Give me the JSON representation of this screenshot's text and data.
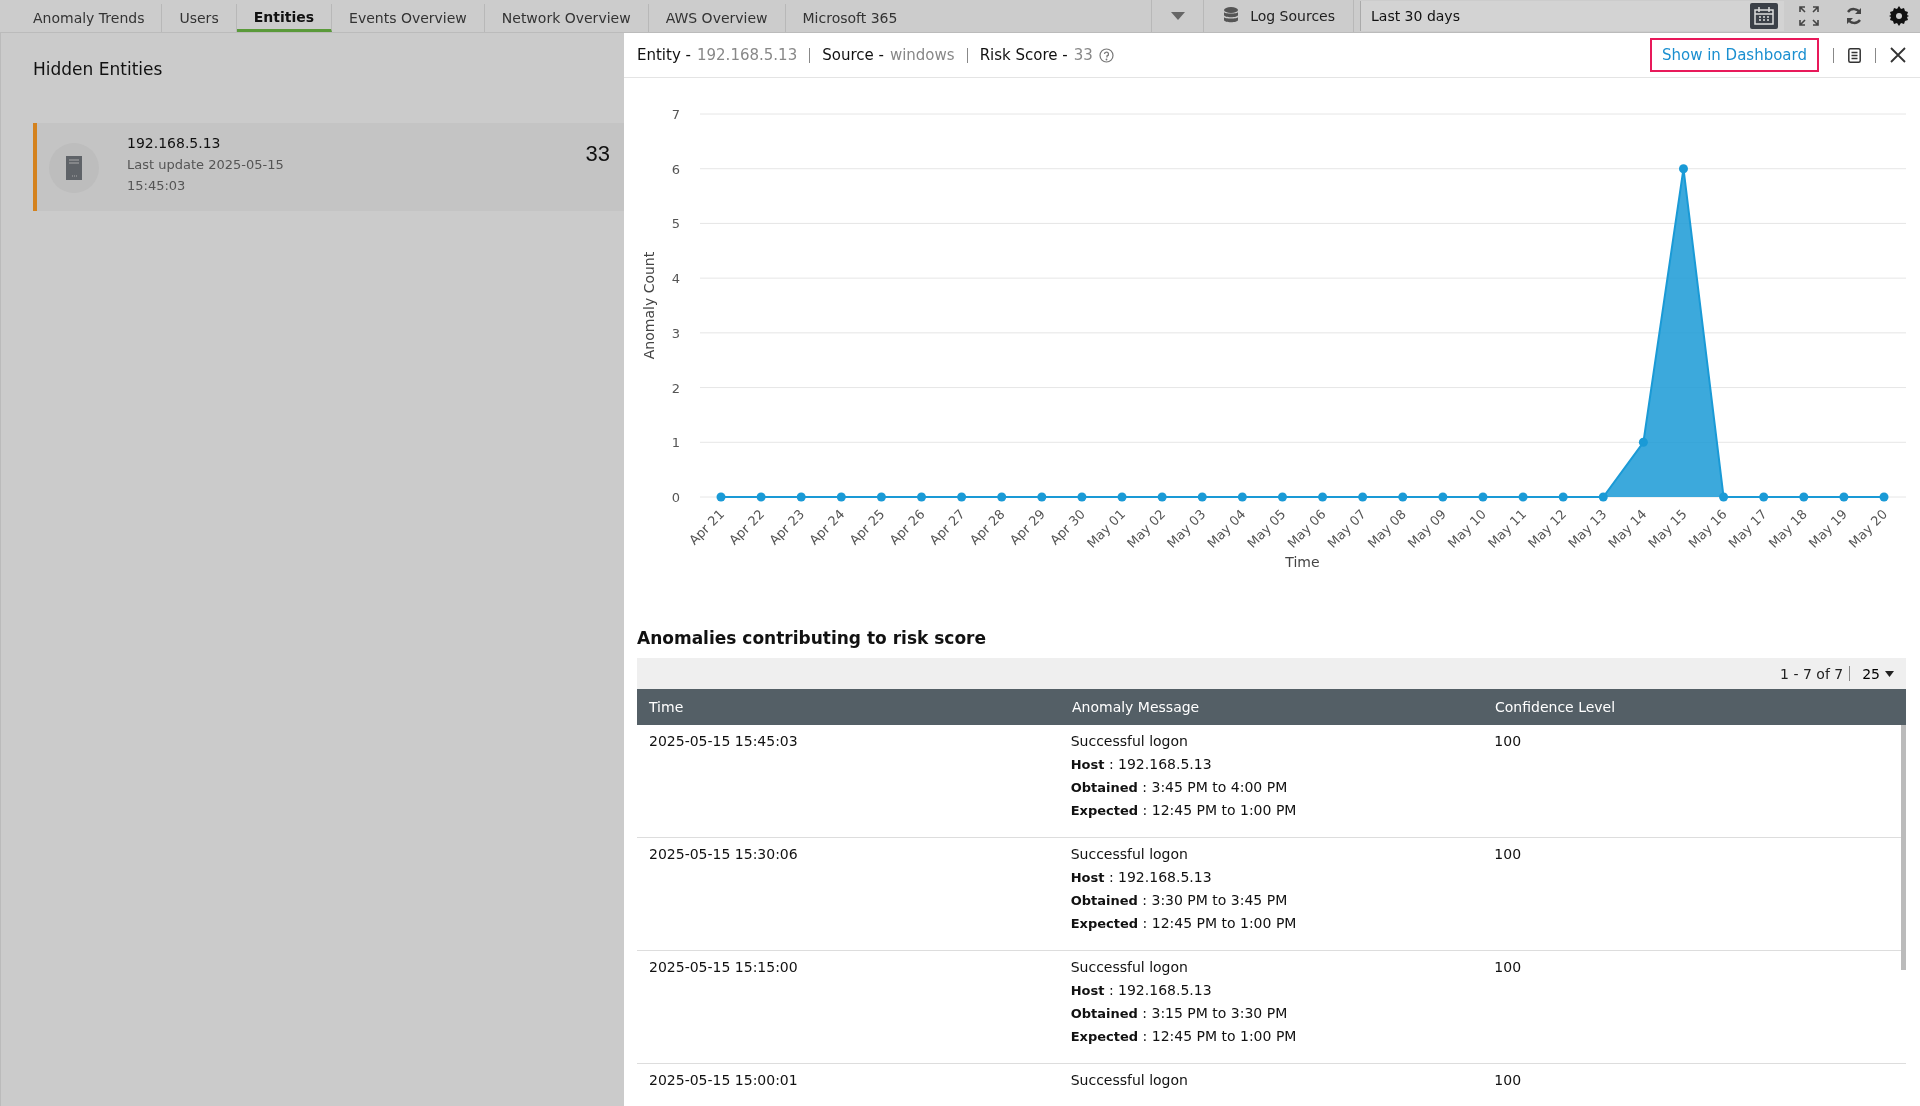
{
  "tabs": [
    {
      "label": "Anomaly Trends",
      "selected": false
    },
    {
      "label": "Users",
      "selected": false
    },
    {
      "label": "Entities",
      "selected": true
    },
    {
      "label": "Events Overview",
      "selected": false
    },
    {
      "label": "Network Overview",
      "selected": false
    },
    {
      "label": "AWS Overview",
      "selected": false
    },
    {
      "label": "Microsoft 365",
      "selected": false
    }
  ],
  "toolbar": {
    "log_sources": "Log Sources",
    "date_range": "Last 30 days"
  },
  "hidden_entities": {
    "title": "Hidden Entities",
    "items": [
      {
        "name": "192.168.5.13",
        "updated": "Last update 2025-05-15",
        "updated_time": "15:45:03",
        "score": "33",
        "selected": true
      }
    ]
  },
  "detail": {
    "entity_label": "Entity -",
    "entity": "192.168.5.13",
    "source_label": "Source -",
    "source": "windows",
    "risk_label": "Risk Score -",
    "risk": "33",
    "show_button": "Show in Dashboard",
    "chart_data": {
      "type": "area",
      "grid": true,
      "xlabel": "Time",
      "ylabel": "Anomaly Count",
      "yticks": [
        0,
        1,
        2,
        3,
        4,
        5,
        6,
        7
      ],
      "ylim": [
        0,
        7
      ],
      "categories": [
        "Apr 21",
        "Apr 22",
        "Apr 23",
        "Apr 24",
        "Apr 25",
        "Apr 26",
        "Apr 27",
        "Apr 28",
        "Apr 29",
        "Apr 30",
        "May 01",
        "May 02",
        "May 03",
        "May 04",
        "May 05",
        "May 06",
        "May 07",
        "May 08",
        "May 09",
        "May 10",
        "May 11",
        "May 12",
        "May 13",
        "May 14",
        "May 15",
        "May 16",
        "May 17",
        "May 18",
        "May 19",
        "May 20"
      ],
      "series": [
        {
          "color": "#1a9ad6",
          "values": [
            0,
            0,
            0,
            0,
            0,
            0,
            0,
            0,
            0,
            0,
            0,
            0,
            0,
            0,
            0,
            0,
            0,
            0,
            0,
            0,
            0,
            0,
            0,
            1,
            6,
            0,
            0,
            0,
            0,
            0
          ]
        }
      ]
    }
  },
  "anomalies": {
    "title": "Anomalies contributing to risk score",
    "pager": "1 - 7 of 7",
    "page_size": "25",
    "columns": [
      "Time",
      "Anomaly Message",
      "Confidence Level"
    ],
    "rows": [
      {
        "time": "2025-05-15 15:45:03",
        "message": [
          "Successful logon",
          "**Host** : 192.168.5.13",
          "**Obtained** : 3:45 PM to 4:00 PM",
          "**Expected** : 12:45 PM to 1:00 PM"
        ],
        "confidence": "100"
      },
      {
        "time": "2025-05-15 15:30:06",
        "message": [
          "Successful logon",
          "**Host** : 192.168.5.13",
          "**Obtained** : 3:30 PM to 3:45 PM",
          "**Expected** : 12:45 PM to 1:00 PM"
        ],
        "confidence": "100"
      },
      {
        "time": "2025-05-15 15:15:00",
        "message": [
          "Successful logon",
          "**Host** : 192.168.5.13",
          "**Obtained** : 3:15 PM to 3:30 PM",
          "**Expected** : 12:45 PM to 1:00 PM"
        ],
        "confidence": "100"
      },
      {
        "time": "2025-05-15 15:00:01",
        "message": [
          "Successful logon"
        ],
        "confidence": "100"
      }
    ]
  }
}
